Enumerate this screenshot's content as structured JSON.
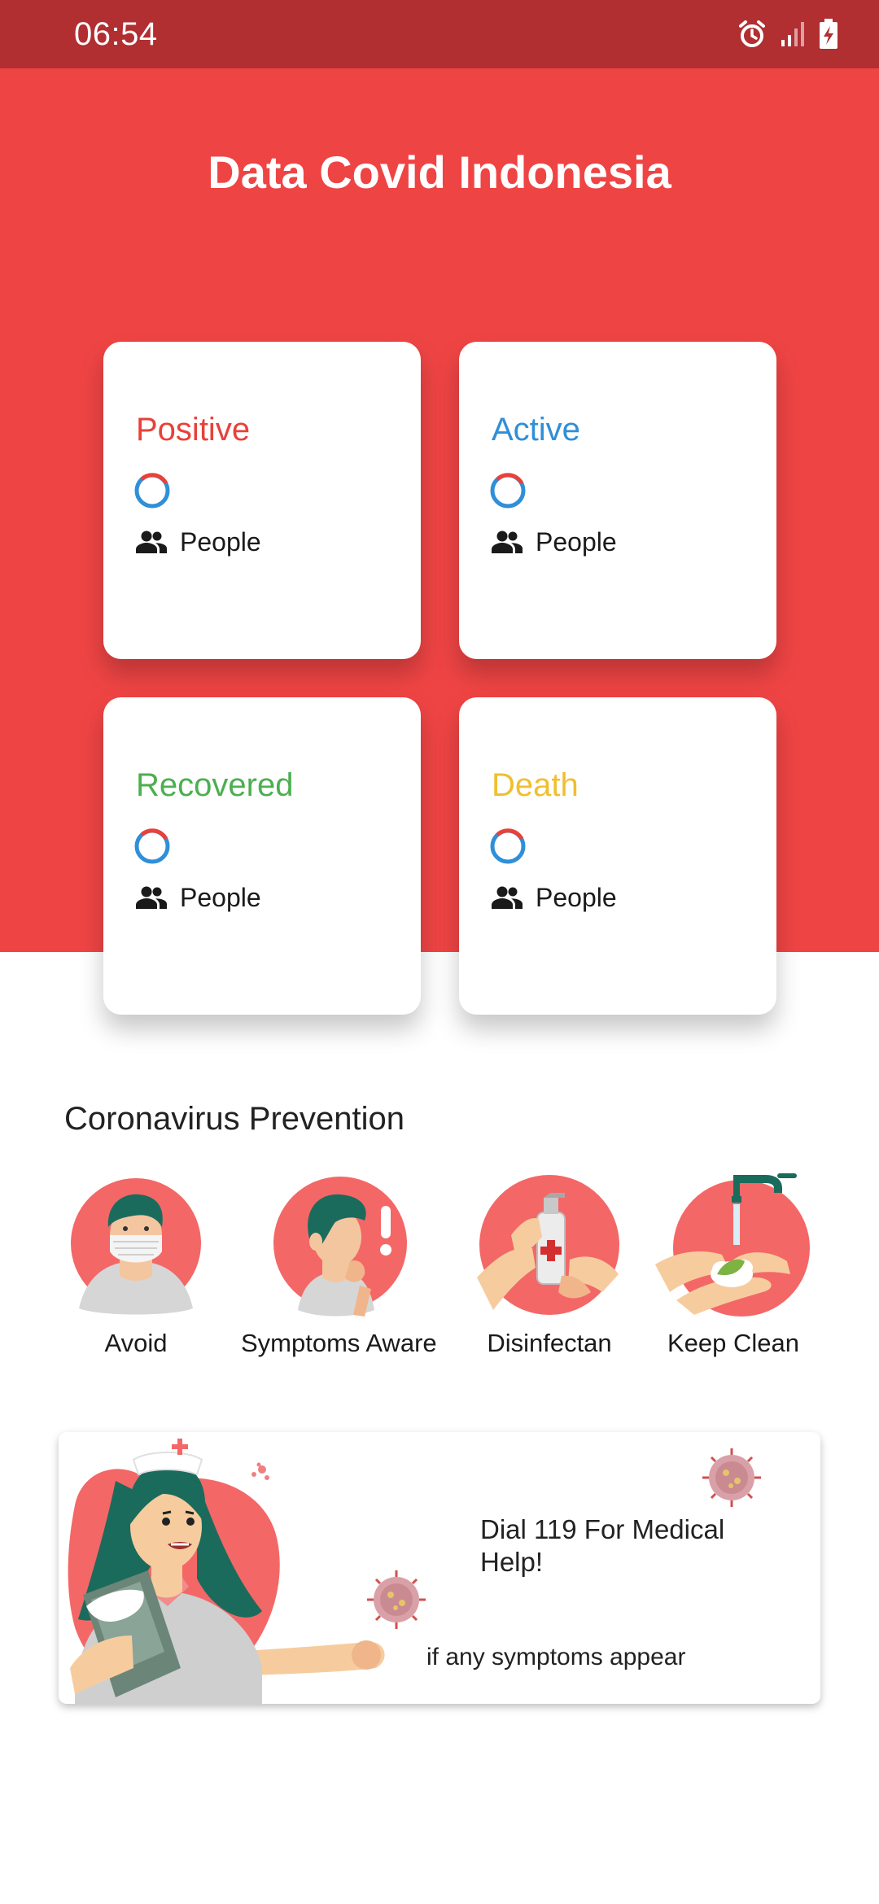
{
  "status_bar": {
    "time": "06:54",
    "icons": [
      "alarm-icon",
      "signal-icon",
      "battery-charging-icon"
    ]
  },
  "header": {
    "title": "Data Covid Indonesia",
    "background_color": "#ef4444"
  },
  "stats": [
    {
      "label": "Positive",
      "unit": "People",
      "color": "#e8413a"
    },
    {
      "label": "Active",
      "unit": "People",
      "color": "#2f8fd8"
    },
    {
      "label": "Recovered",
      "unit": "People",
      "color": "#4caf50"
    },
    {
      "label": "Death",
      "unit": "People",
      "color": "#f0bf2e"
    }
  ],
  "prevention": {
    "title": "Coronavirus Prevention",
    "items": [
      {
        "label": "Avoid",
        "icon": "mask-person-icon"
      },
      {
        "label": "Symptoms Aware",
        "icon": "coughing-person-icon"
      },
      {
        "label": "Disinfectan",
        "icon": "hand-sanitizer-icon"
      },
      {
        "label": "Keep Clean",
        "icon": "hand-washing-icon"
      }
    ]
  },
  "banner": {
    "title": "Dial 119 For Medical Help!",
    "subtitle": "if any symptoms appear",
    "icon": "nurse-illustration-icon"
  }
}
